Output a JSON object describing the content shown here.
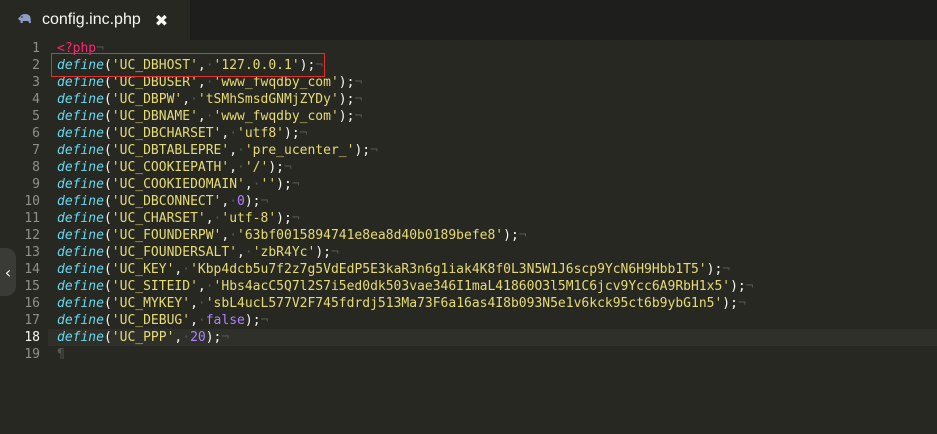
{
  "tab": {
    "label": "config.inc.php",
    "close_glyph": "✖",
    "icon": "php-elephant-icon"
  },
  "editor": {
    "active_line": 18,
    "lines": [
      "<?php",
      "define('UC_DBHOST', '127.0.0.1');",
      "define('UC_DBUSER', 'www_fwqdby_com');",
      "define('UC_DBPW', 'tSMhSmsdGNMjZYDy');",
      "define('UC_DBNAME', 'www_fwqdby_com');",
      "define('UC_DBCHARSET', 'utf8');",
      "define('UC_DBTABLEPRE', 'pre_ucenter_');",
      "define('UC_COOKIEPATH', '/');",
      "define('UC_COOKIEDOMAIN', '');",
      "define('UC_DBCONNECT', 0);",
      "define('UC_CHARSET', 'utf-8');",
      "define('UC_FOUNDERPW', '63bf0015894741e8ea8d40b0189befe8');",
      "define('UC_FOUNDERSALT', 'zbR4Yc');",
      "define('UC_KEY', 'Kbp4dcb5u7f2z7g5VdEdP5E3kaR3n6g1iak4K8f0L3N5W1J6scp9YcN6H9Hbb1T5');",
      "define('UC_SITEID', 'Hbs4acC5Q7l2S7i5ed0dk503vae346I1maL41860O3l5M1C6jcv9Ycc6A9RbH1x5');",
      "define('UC_MYKEY', 'sbL4ucL577V2F745fdrdj513Ma73F6a16as4I8b093N5e1v6kck95ct6b9ybG1n5');",
      "define('UC_DEBUG', false);",
      "define('UC_PPP', 20);",
      ""
    ]
  },
  "highlight": {
    "line": 2,
    "color": "#e0332c"
  },
  "sidebar_toggle": {
    "glyph": "‹",
    "icon": "chevron-left-icon"
  }
}
